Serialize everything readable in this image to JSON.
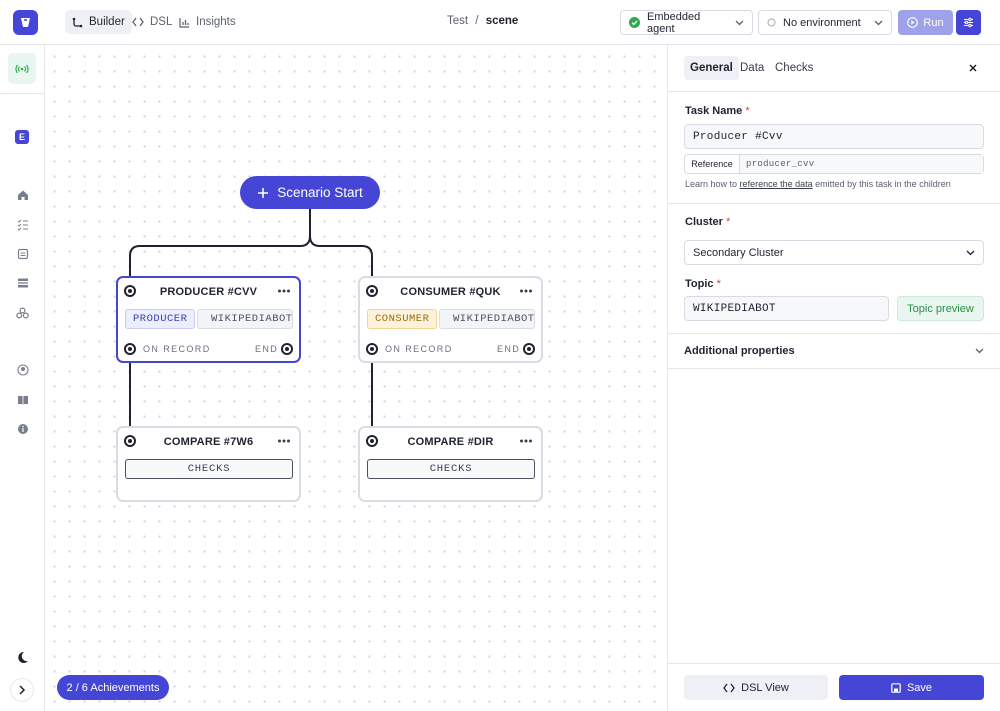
{
  "topbar": {
    "tabs": [
      {
        "label": "Builder",
        "active": true
      },
      {
        "label": "DSL",
        "active": false
      },
      {
        "label": "Insights",
        "active": false
      }
    ],
    "breadcrumb": {
      "parent": "Test",
      "separator": "/",
      "current": "scene"
    },
    "agent_select": "Embedded agent",
    "environment_select": "No environment",
    "run_label": "Run"
  },
  "sidebar": {
    "badge": "E"
  },
  "canvas": {
    "start_label": "Scenario Start",
    "nodes": [
      {
        "title": "PRODUCER #CVV",
        "type_tag": "PRODUCER",
        "topic_tag": "WIKIPEDIABOT",
        "left_label": "ON RECORD",
        "right_label": "END",
        "selected": true
      },
      {
        "title": "CONSUMER #QUK",
        "type_tag": "CONSUMER",
        "topic_tag": "WIKIPEDIABOT",
        "left_label": "ON RECORD",
        "right_label": "END",
        "selected": false
      },
      {
        "title": "COMPARE #7W6",
        "checks_label": "CHECKS"
      },
      {
        "title": "COMPARE #DIR",
        "checks_label": "CHECKS"
      }
    ],
    "achievements": "2 / 6 Achievements"
  },
  "panel": {
    "tabs": [
      {
        "label": "General",
        "active": true
      },
      {
        "label": "Data",
        "active": false
      },
      {
        "label": "Checks",
        "active": false
      }
    ],
    "task_name_label": "Task Name",
    "required_mark": "*",
    "task_name_value": "Producer #Cvv",
    "reference_label": "Reference",
    "reference_value": "producer_cvv",
    "help_prefix": "Learn how to",
    "help_link": "reference the data",
    "help_suffix": "emitted by this task in the children",
    "cluster_label": "Cluster",
    "cluster_value": "Secondary Cluster",
    "topic_label": "Topic",
    "topic_value": "WIKIPEDIABOT",
    "topic_preview": "Topic preview",
    "additional_properties": "Additional properties",
    "dsl_view": "DSL View",
    "save": "Save"
  },
  "colors": {
    "accent": "#4545d6",
    "success": "#2fa84f",
    "danger": "#e23b3b"
  }
}
